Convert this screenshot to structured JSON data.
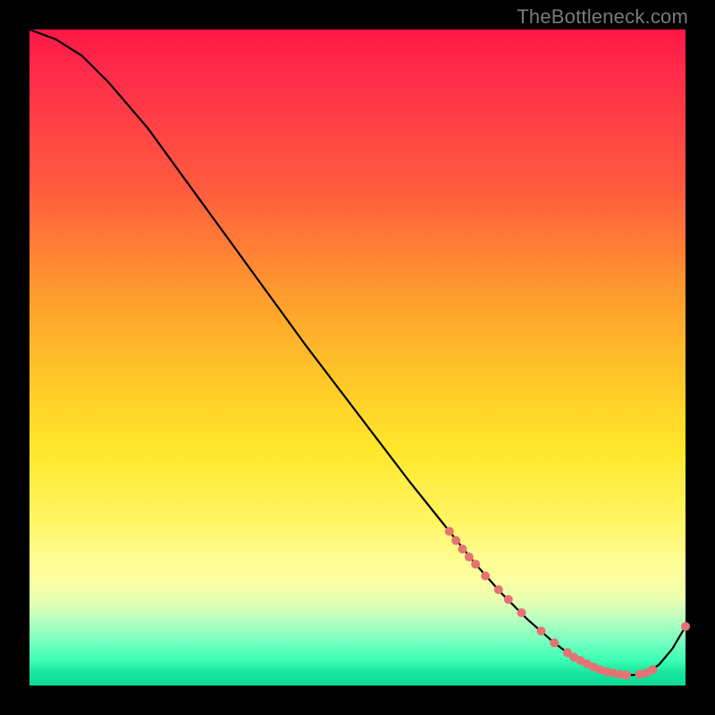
{
  "watermark": "TheBottleneck.com",
  "chart_data": {
    "type": "line",
    "title": "",
    "xlabel": "",
    "ylabel": "",
    "xlim": [
      0,
      100
    ],
    "ylim": [
      0,
      100
    ],
    "grid": false,
    "legend": false,
    "series": [
      {
        "name": "bottleneck-curve",
        "color": "#000000",
        "x": [
          0,
          4,
          8,
          12,
          18,
          26,
          34,
          42,
          50,
          58,
          64,
          68,
          72,
          76,
          80,
          82,
          84,
          86,
          88,
          90,
          92,
          94,
          96,
          98,
          100
        ],
        "y": [
          100,
          98.5,
          96,
          92,
          85,
          74,
          63,
          52,
          41.5,
          31,
          23.5,
          18.5,
          14,
          10,
          6.5,
          5,
          3.8,
          2.8,
          2.1,
          1.7,
          1.6,
          1.9,
          3.2,
          5.6,
          9
        ]
      }
    ],
    "markers": {
      "name": "highlight-points",
      "color": "#e57373",
      "radius_px": 5,
      "x": [
        64,
        65,
        66,
        67,
        68,
        69.5,
        71.5,
        73,
        75,
        78,
        80,
        82,
        83,
        84,
        85,
        86,
        87,
        88,
        89,
        90,
        91,
        93,
        94,
        95,
        100
      ],
      "y": [
        23.5,
        22.1,
        20.8,
        19.6,
        18.5,
        16.7,
        14.6,
        13.1,
        11.1,
        8.3,
        6.5,
        5.0,
        4.3,
        3.8,
        3.3,
        2.8,
        2.4,
        2.1,
        1.9,
        1.7,
        1.6,
        1.7,
        1.9,
        2.4,
        9
      ]
    }
  }
}
